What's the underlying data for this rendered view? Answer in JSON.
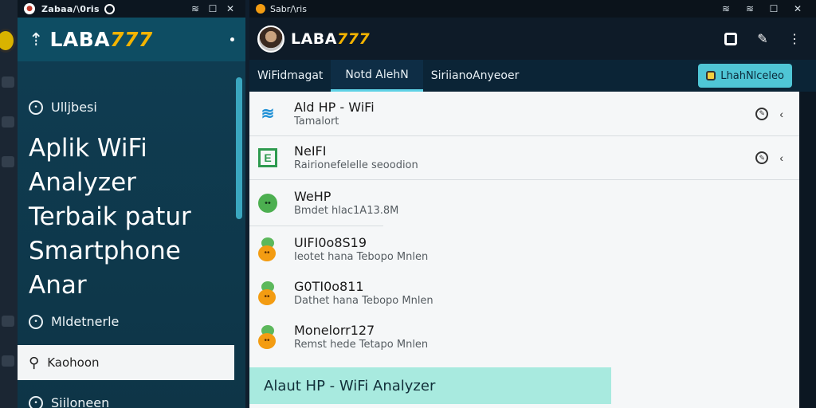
{
  "left_window": {
    "title": "Zabaa/\\0ris",
    "brand_a": "LABA",
    "brand_b": "777",
    "nav_top": "Ulljbesi",
    "hero_lines": [
      "Aplik WiFi",
      "Analyzer",
      "Terbaik patur",
      "Smartphone",
      "Anar"
    ],
    "nav_mid": "Mldetnerle",
    "search_label": "Kaohoon",
    "nav_bottom": "Siiloneen"
  },
  "right_window": {
    "title": "Sabr/\\ris",
    "brand_a": "LABA",
    "brand_b": "777",
    "tabs": [
      "WiFidmagat",
      "Notd AlehN",
      "SiriianoAnyeoer"
    ],
    "tab_button": "LhahNlceleo",
    "items": [
      {
        "title": "Ald HP - WiFi",
        "subtitle": "Tamalort",
        "icon": "wifi-icon"
      },
      {
        "title": "NeIFI",
        "subtitle": "Rairionefelelle seoodion",
        "icon": "box-icon"
      },
      {
        "title": "WeHP",
        "subtitle": "Bmdet hlac1A13.8M",
        "icon": "green-circle-icon"
      },
      {
        "title": "UIFI0o8S19",
        "subtitle": "Ieotet hana Tebopo Mnlen",
        "icon": "dual-circle-icon"
      },
      {
        "title": "G0TI0o811",
        "subtitle": "Dathet hana Tebopo Mnlen",
        "icon": "dual-circle-icon"
      },
      {
        "title": "Monelorr127",
        "subtitle": "Remst hede Tetapo Mnlen",
        "icon": "dual-circle-icon"
      }
    ],
    "banner": "Alaut HP - WiFi Analyzer"
  },
  "colors": {
    "accent": "#4fc6d6",
    "brand_gold": "#f4b400",
    "left_panel": "#0f3c51",
    "banner": "#a8eadf"
  }
}
